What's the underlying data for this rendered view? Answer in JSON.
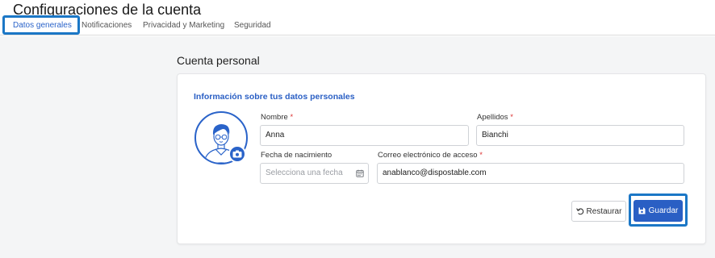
{
  "header": {
    "title": "Configuraciones de la cuenta",
    "tabs": [
      {
        "label": "Datos generales",
        "active": true
      },
      {
        "label": "Notificaciones",
        "active": false
      },
      {
        "label": "Privacidad y Marketing",
        "active": false
      },
      {
        "label": "Seguridad",
        "active": false
      }
    ]
  },
  "section": {
    "title": "Cuenta personal",
    "card_heading": "Información sobre tus datos personales"
  },
  "form": {
    "nombre": {
      "label": "Nombre",
      "required_mark": "*",
      "value": "Anna"
    },
    "apellidos": {
      "label": "Apellidos",
      "required_mark": "*",
      "value": "Bianchi"
    },
    "fecha": {
      "label": "Fecha de nacimiento",
      "placeholder": "Selecciona una fecha",
      "value": ""
    },
    "correo": {
      "label": "Correo electrónico de acceso",
      "required_mark": "*",
      "value": "anablanco@dispostable.com"
    }
  },
  "actions": {
    "restore_label": "Restaurar",
    "save_label": "Guardar"
  },
  "icons": {
    "restore": "undo-icon",
    "save": "floppy-disk-icon",
    "camera": "camera-icon",
    "calendar": "calendar-icon",
    "avatar": "user-avatar-illustration"
  },
  "colors": {
    "accent": "#2a5fc4",
    "highlight": "#1b77c6",
    "required": "#d33333",
    "background": "#f4f5f6"
  }
}
